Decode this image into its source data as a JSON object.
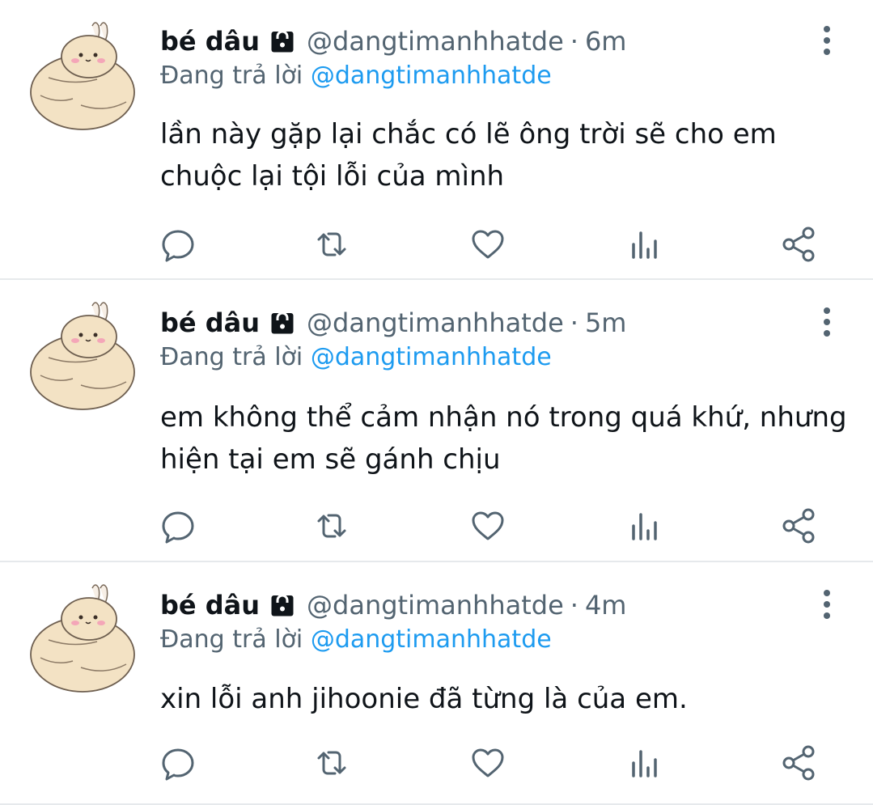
{
  "tweets": [
    {
      "name": "bé dâu",
      "handle": "@dangtimanhhatde",
      "separator": "·",
      "time": "6m",
      "reply_prefix": "Đang trả lời",
      "reply_to": "@dangtimanhhatde",
      "text": "lần này gặp lại chắc có lẽ ông trời sẽ cho em chuộc lại tội lỗi của mình"
    },
    {
      "name": "bé dâu",
      "handle": "@dangtimanhhatde",
      "separator": "·",
      "time": "5m",
      "reply_prefix": "Đang trả lời",
      "reply_to": "@dangtimanhhatde",
      "text": "em không thể cảm nhận nó trong quá khứ, nhưng hiện tại em sẽ gánh chịu"
    },
    {
      "name": "bé dâu",
      "handle": "@dangtimanhhatde",
      "separator": "·",
      "time": "4m",
      "reply_prefix": "Đang trả lời",
      "reply_to": "@dangtimanhhatde",
      "text": "xin lỗi anh jihoonie đã từng là của em."
    }
  ],
  "icons": {
    "verified_lock": "lock-icon",
    "more": "more-vertical-icon",
    "reply": "comment-icon",
    "retweet": "retweet-icon",
    "like": "heart-icon",
    "stats": "bar-chart-icon",
    "share": "share-icon"
  },
  "colors": {
    "text_primary": "#0f1419",
    "text_secondary": "#536471",
    "accent": "#1d9bf0",
    "divider": "#e6e9ec",
    "avatar_fill": "#f3e2c4"
  }
}
